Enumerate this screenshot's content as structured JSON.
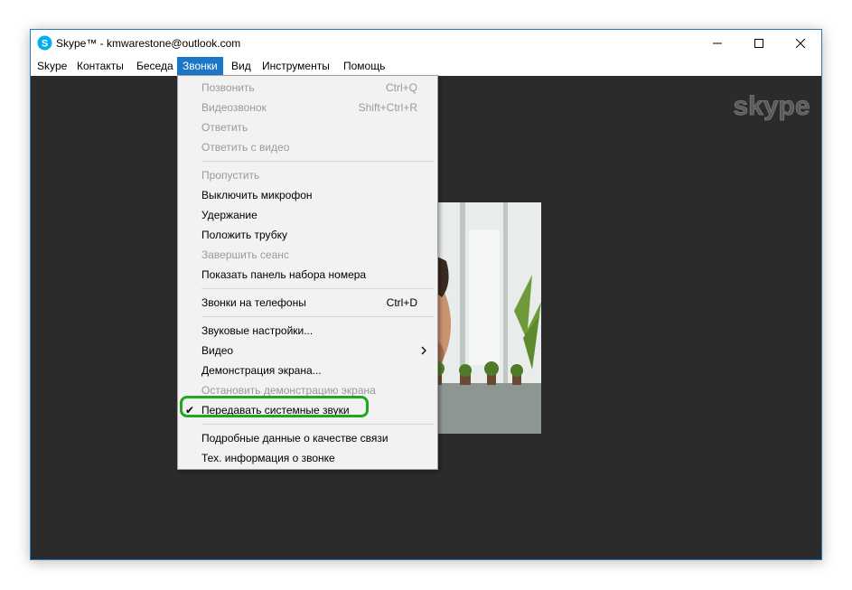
{
  "window": {
    "title": "Skype™ - kmwarestone@outlook.com",
    "accent_color": "#2b79b8",
    "app_icon": "skype-icon"
  },
  "menubar": {
    "items": [
      {
        "label": "Skype"
      },
      {
        "label": "Контакты"
      },
      {
        "label": "Беседа"
      },
      {
        "label": "Звонки"
      },
      {
        "label": "Вид"
      },
      {
        "label": "Инструменты"
      },
      {
        "label": "Помощь"
      }
    ],
    "active": "Звонки"
  },
  "call_menu": {
    "items": [
      {
        "label": "Позвонить",
        "shortcut": "Ctrl+Q",
        "disabled": true
      },
      {
        "label": "Видеозвонок",
        "shortcut": "Shift+Ctrl+R",
        "disabled": true
      },
      {
        "label": "Ответить",
        "disabled": true
      },
      {
        "label": "Ответить с видео",
        "disabled": true
      },
      {
        "label": "Пропустить",
        "disabled": true
      },
      {
        "label": "Выключить микрофон",
        "disabled": false
      },
      {
        "label": "Удержание",
        "disabled": false
      },
      {
        "label": "Положить трубку",
        "disabled": false
      },
      {
        "label": "Завершить сеанс",
        "disabled": true
      },
      {
        "label": "Показать панель набора номера",
        "disabled": false
      },
      {
        "label": "Звонки на телефоны",
        "shortcut": "Ctrl+D",
        "disabled": false
      },
      {
        "label": "Звуковые настройки...",
        "disabled": false
      },
      {
        "label": "Видео",
        "submenu": true,
        "disabled": false
      },
      {
        "label": "Демонстрация экрана...",
        "disabled": false
      },
      {
        "label": "Остановить демонстрацию экрана",
        "disabled": true
      },
      {
        "label": "Передавать системные звуки",
        "checked": true,
        "disabled": false
      },
      {
        "label": "Подробные данные о качестве связи",
        "disabled": false
      },
      {
        "label": "Тех. информация о звонке",
        "disabled": false
      }
    ],
    "highlight_color": "#1fa81f"
  },
  "content": {
    "watermark": "skype",
    "background": "#2b2b2b"
  }
}
